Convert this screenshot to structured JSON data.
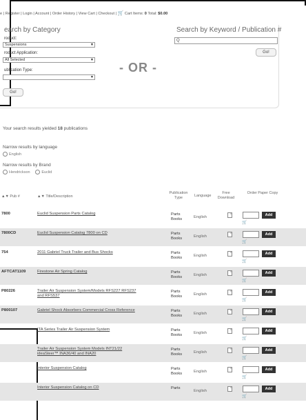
{
  "topnav": {
    "links": [
      "e",
      "Register",
      "Login",
      "Account",
      "Order History",
      "View Cart",
      "Checkout"
    ],
    "cart_label": "Cart Items:",
    "cart_items": "0",
    "total_label": "Total:",
    "total_value": "$0.00"
  },
  "category": {
    "title": "earch by Category",
    "product_label": "roduct:",
    "product_value": "Suspensions",
    "application_label": "roduct Application:",
    "application_value": "All Selected",
    "pubtype_label": "ublication Type:",
    "pubtype_value": "",
    "go_label": "Go!"
  },
  "or_text": "- OR -",
  "keyword": {
    "title": "Search by Keyword / Publication #",
    "input_value": "Q",
    "go_label": "Go!"
  },
  "results": {
    "summary_prefix": "Your search results yielded",
    "count": "18",
    "summary_suffix": "publications",
    "narrow_language": "Narrow results by language",
    "language_options": [
      "English"
    ],
    "narrow_brand": "Narrow results by Brand",
    "brand_options": [
      "Hendrickson",
      "Euclid"
    ]
  },
  "table": {
    "headers": {
      "pub": "▲▼ Pub #",
      "title": "▲▼ Title/Description",
      "type": "Publication Type",
      "language": "Language",
      "download": "Free Download",
      "order": "Order Paper Copy"
    },
    "add_label": "Add",
    "rows": [
      {
        "pub": "7800",
        "title": "Euclid Suspension Parts Catalog",
        "title2": "",
        "type": "Parts Books",
        "language": "English"
      },
      {
        "pub": "7800CD",
        "title": "Euclid Suspension Catalog 7800 on CD",
        "title2": "",
        "type": "Parts Books",
        "language": "English"
      },
      {
        "pub": "754",
        "title": "2011 Gabriel Truck Trailer and Bus Shocks",
        "title2": "",
        "type": "Parts Books",
        "language": "English"
      },
      {
        "pub": "AFTCAT1109",
        "title": "Firestone Air Spring Catalog",
        "title2": "",
        "type": "Parts Books",
        "language": "English"
      },
      {
        "pub": "P80226",
        "title": "Trailer Air Suspension System/Models RFS227 RFS237",
        "title2": "and RFS537",
        "type": "Parts Books",
        "language": "English"
      },
      {
        "pub": "P800107",
        "title": "Gabriel Shock Absorbers Commercial Cross Reference",
        "title2": "",
        "type": "Parts Books",
        "language": "English"
      },
      {
        "pub": "",
        "title": "ITA Series Trailer Air Suspension System",
        "title2": "",
        "type": "Parts Books",
        "language": "English"
      },
      {
        "pub": "",
        "title": "Trailer Air Suspension System Models INT21/22",
        "title2": "ideaSteer™ INA36/40 and INA20",
        "type": "Parts Books",
        "language": "English"
      },
      {
        "pub": "",
        "title": "Interior Suspension Catalog",
        "title2": "",
        "type": "Parts Books",
        "language": "English"
      },
      {
        "pub": "",
        "title": "Interior Suspension Catalog on CD",
        "title2": "",
        "type": "Parts",
        "language": "English"
      }
    ]
  }
}
